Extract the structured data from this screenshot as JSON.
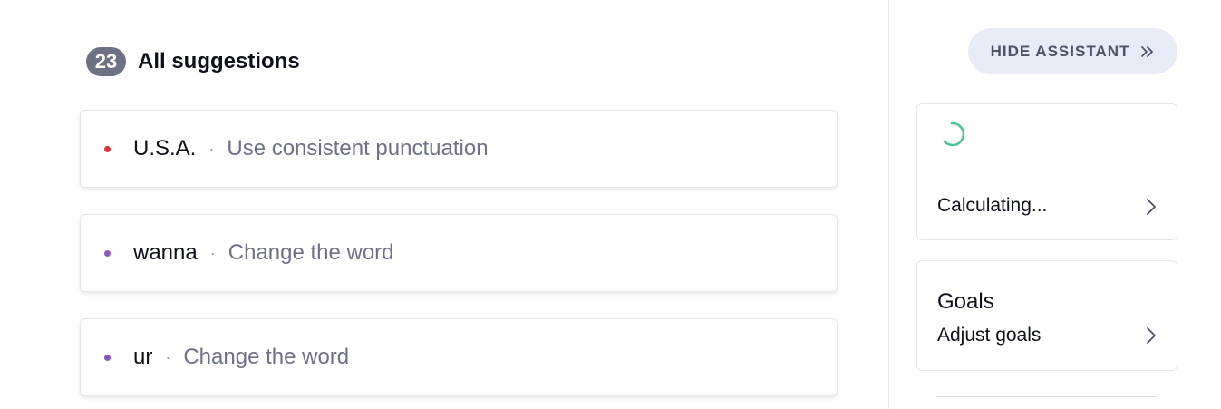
{
  "suggestions_header": {
    "count": "23",
    "title": "All suggestions"
  },
  "suggestions": [
    {
      "word": "U.S.A.",
      "separator": "·",
      "hint": "Use consistent punctuation",
      "dot_color": "#d9363e"
    },
    {
      "word": "wanna",
      "separator": "·",
      "hint": "Change the word",
      "dot_color": "#8f57c4"
    },
    {
      "word": "ur",
      "separator": "·",
      "hint": "Change the word",
      "dot_color": "#8f57c4"
    }
  ],
  "sidebar": {
    "hide_button": {
      "label": "HIDE ASSISTANT",
      "icon": "double-chevron-right-icon"
    },
    "score_panel": {
      "status": "Calculating...",
      "spinner_color": "#4ac29b",
      "icon": "chevron-right-icon"
    },
    "goals_panel": {
      "title": "Goals",
      "subtitle": "Adjust goals",
      "icon": "chevron-right-icon"
    }
  },
  "colors": {
    "badge_bg": "#6d7185",
    "hide_button_bg": "#e8eaf6",
    "text_primary": "#0e101a",
    "text_secondary": "#6d7185"
  }
}
